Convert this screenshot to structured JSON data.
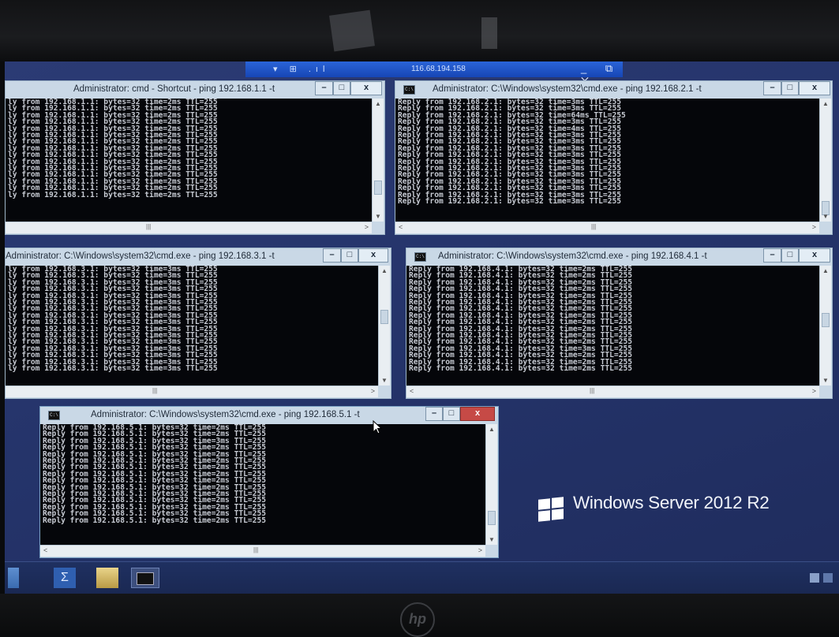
{
  "rdp_bar": {
    "pin_icons": "▾ ⊞ .ıl",
    "host": "116.68.194.158",
    "controls": "_ ⧉ ✕"
  },
  "windows": [
    {
      "title": "Administrator: cmd - Shortcut - ping  192.168.1.1 -t",
      "lines": [
        "ly from 192.168.1.1: bytes=32 time=2ms TTL=255",
        "ly from 192.168.1.1: bytes=32 time=2ms TTL=255",
        "ly from 192.168.1.1: bytes=32 time=2ms TTL=255",
        "ly from 192.168.1.1: bytes=32 time=2ms TTL=255",
        "ly from 192.168.1.1: bytes=32 time=2ms TTL=255",
        "ly from 192.168.1.1: bytes=32 time=2ms TTL=255",
        "ly from 192.168.1.1: bytes=32 time=2ms TTL=255",
        "ly from 192.168.1.1: bytes=32 time=2ms TTL=255",
        "ly from 192.168.1.1: bytes=32 time=2ms TTL=255",
        "ly from 192.168.1.1: bytes=32 time=2ms TTL=255",
        "ly from 192.168.1.1: bytes=32 time=2ms TTL=255",
        "ly from 192.168.1.1: bytes=32 time=2ms TTL=255",
        "ly from 192.168.1.1: bytes=32 time=2ms TTL=255",
        "ly from 192.168.1.1: bytes=32 time=2ms TTL=255",
        "ly from 192.168.1.1: bytes=32 time=2ms TTL=255"
      ]
    },
    {
      "title": "Administrator: C:\\Windows\\system32\\cmd.exe - ping  192.168.2.1 -t",
      "lines": [
        "Reply from 192.168.2.1: bytes=32 time=3ms TTL=255",
        "Reply from 192.168.2.1: bytes=32 time=3ms TTL=255",
        "Reply from 192.168.2.1: bytes=32 time=64ms TTL=255",
        "Reply from 192.168.2.1: bytes=32 time=3ms TTL=255",
        "Reply from 192.168.2.1: bytes=32 time=4ms TTL=255",
        "Reply from 192.168.2.1: bytes=32 time=3ms TTL=255",
        "Reply from 192.168.2.1: bytes=32 time=3ms TTL=255",
        "Reply from 192.168.2.1: bytes=32 time=3ms TTL=255",
        "Reply from 192.168.2.1: bytes=32 time=3ms TTL=255",
        "Reply from 192.168.2.1: bytes=32 time=3ms TTL=255",
        "Reply from 192.168.2.1: bytes=32 time=3ms TTL=255",
        "Reply from 192.168.2.1: bytes=32 time=3ms TTL=255",
        "Reply from 192.168.2.1: bytes=32 time=3ms TTL=255",
        "Reply from 192.168.2.1: bytes=32 time=3ms TTL=255",
        "Reply from 192.168.2.1: bytes=32 time=3ms TTL=255",
        "Reply from 192.168.2.1: bytes=32 time=3ms TTL=255"
      ]
    },
    {
      "title": "Administrator: C:\\Windows\\system32\\cmd.exe - ping  192.168.3.1 -t",
      "lines": [
        "ly from 192.168.3.1: bytes=32 time=3ms TTL=255",
        "ly from 192.168.3.1: bytes=32 time=3ms TTL=255",
        "ly from 192.168.3.1: bytes=32 time=3ms TTL=255",
        "ly from 192.168.3.1: bytes=32 time=3ms TTL=255",
        "ly from 192.168.3.1: bytes=32 time=3ms TTL=255",
        "ly from 192.168.3.1: bytes=32 time=3ms TTL=255",
        "ly from 192.168.3.1: bytes=32 time=3ms TTL=255",
        "ly from 192.168.3.1: bytes=32 time=3ms TTL=255",
        "ly from 192.168.3.1: bytes=32 time=3ms TTL=255",
        "ly from 192.168.3.1: bytes=32 time=3ms TTL=255",
        "ly from 192.168.3.1: bytes=32 time=3ms TTL=255",
        "ly from 192.168.3.1: bytes=32 time=3ms TTL=255",
        "ly from 192.168.3.1: bytes=32 time=3ms TTL=255",
        "ly from 192.168.3.1: bytes=32 time=3ms TTL=255",
        "ly from 192.168.3.1: bytes=32 time=3ms TTL=255",
        "ly from 192.168.3.1: bytes=32 time=3ms TTL=255"
      ]
    },
    {
      "title": "Administrator: C:\\Windows\\system32\\cmd.exe - ping  192.168.4.1 -t",
      "lines": [
        "Reply from 192.168.4.1: bytes=32 time=2ms TTL=255",
        "Reply from 192.168.4.1: bytes=32 time=2ms TTL=255",
        "Reply from 192.168.4.1: bytes=32 time=2ms TTL=255",
        "Reply from 192.168.4.1: bytes=32 time=2ms TTL=255",
        "Reply from 192.168.4.1: bytes=32 time=2ms TTL=255",
        "Reply from 192.168.4.1: bytes=32 time=2ms TTL=255",
        "Reply from 192.168.4.1: bytes=32 time=2ms TTL=255",
        "Reply from 192.168.4.1: bytes=32 time=2ms TTL=255",
        "Reply from 192.168.4.1: bytes=32 time=2ms TTL=255",
        "Reply from 192.168.4.1: bytes=32 time=2ms TTL=255",
        "Reply from 192.168.4.1: bytes=32 time=2ms TTL=255",
        "Reply from 192.168.4.1: bytes=32 time=2ms TTL=255",
        "Reply from 192.168.4.1: bytes=32 time=3ms TTL=255",
        "Reply from 192.168.4.1: bytes=32 time=2ms TTL=255",
        "Reply from 192.168.4.1: bytes=32 time=2ms TTL=255",
        "Reply from 192.168.4.1: bytes=32 time=2ms TTL=255"
      ]
    },
    {
      "title": "Administrator: C:\\Windows\\system32\\cmd.exe - ping  192.168.5.1 -t",
      "lines": [
        "Reply from 192.168.5.1: bytes=32 time=2ms TTL=255",
        "Reply from 192.168.5.1: bytes=32 time=2ms TTL=255",
        "Reply from 192.168.5.1: bytes=32 time=3ms TTL=255",
        "Reply from 192.168.5.1: bytes=32 time=2ms TTL=255",
        "Reply from 192.168.5.1: bytes=32 time=2ms TTL=255",
        "Reply from 192.168.5.1: bytes=32 time=2ms TTL=255",
        "Reply from 192.168.5.1: bytes=32 time=2ms TTL=255",
        "Reply from 192.168.5.1: bytes=32 time=2ms TTL=255",
        "Reply from 192.168.5.1: bytes=32 time=2ms TTL=255",
        "Reply from 192.168.5.1: bytes=32 time=2ms TTL=255",
        "Reply from 192.168.5.1: bytes=32 time=2ms TTL=255",
        "Reply from 192.168.5.1: bytes=32 time=2ms TTL=255",
        "Reply from 192.168.5.1: bytes=32 time=2ms TTL=255",
        "Reply from 192.168.5.1: bytes=32 time=2ms TTL=255",
        "Reply from 192.168.5.1: bytes=32 time=2ms TTL=255"
      ]
    }
  ],
  "window_buttons": {
    "minimize": "–",
    "maximize": "□",
    "close": "x"
  },
  "branding": {
    "text": "Windows Server 2012 R2"
  },
  "taskbar": {
    "items": [
      "server-manager-icon",
      "powershell-icon",
      "file-explorer-icon",
      "command-prompt-icon"
    ],
    "tray": [
      "network-icon",
      "language-icon"
    ]
  },
  "colors": {
    "desktop": "#243369",
    "console_bg": "#05060a",
    "console_text": "#c7cbd3",
    "window_chrome": "#c9d8e6",
    "close_active": "#c64a46"
  },
  "bezel": {
    "hp_logo": "hp"
  }
}
